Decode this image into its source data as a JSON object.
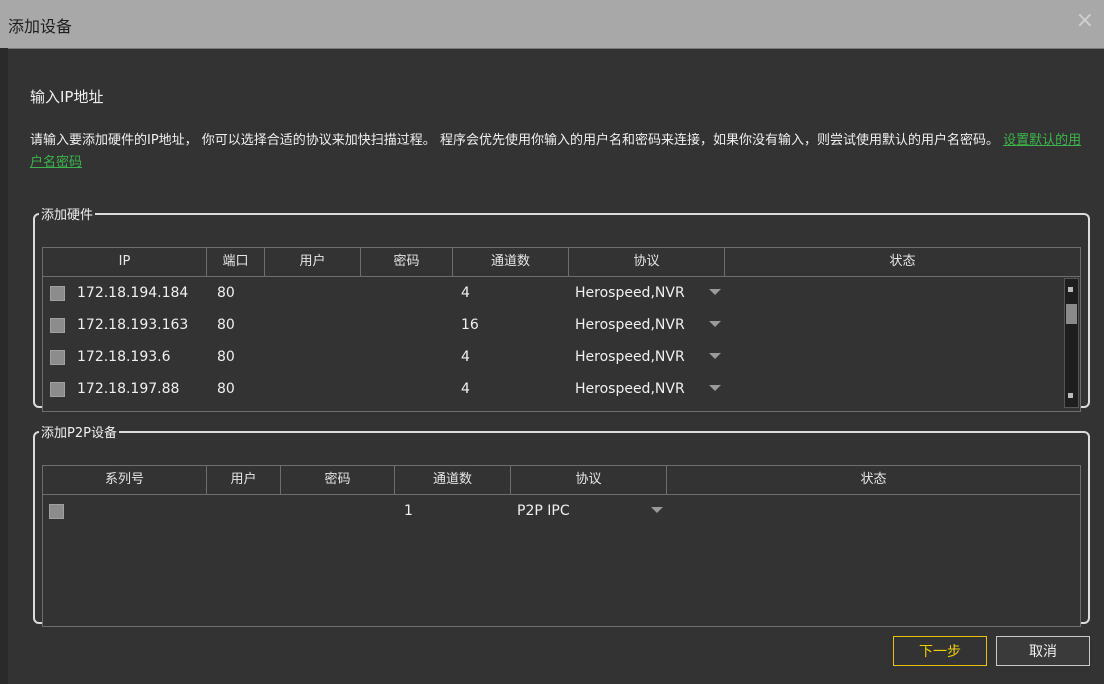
{
  "window": {
    "title": "添加设备",
    "close_icon": "×"
  },
  "heading": "输入IP地址",
  "description": {
    "text": "请输入要添加硬件的IP地址， 你可以选择合适的协议来加快扫描过程。 程序会优先使用你输入的用户名和密码来连接，如果你没有输入，则尝试使用默认的用户名密码。",
    "link": "设置默认的用户名密码"
  },
  "hardware_group": {
    "legend": "添加硬件",
    "columns": [
      "IP",
      "端口",
      "用户",
      "密码",
      "通道数",
      "协议",
      "状态"
    ],
    "rows": [
      {
        "ip": "172.18.194.184",
        "port": "80",
        "user": "",
        "password": "",
        "channels": "4",
        "protocol": "Herospeed,NVR",
        "status": ""
      },
      {
        "ip": "172.18.193.163",
        "port": "80",
        "user": "",
        "password": "",
        "channels": "16",
        "protocol": "Herospeed,NVR",
        "status": ""
      },
      {
        "ip": "172.18.193.6",
        "port": "80",
        "user": "",
        "password": "",
        "channels": "4",
        "protocol": "Herospeed,NVR",
        "status": ""
      },
      {
        "ip": "172.18.197.88",
        "port": "80",
        "user": "",
        "password": "",
        "channels": "4",
        "protocol": "Herospeed,NVR",
        "status": ""
      }
    ]
  },
  "p2p_group": {
    "legend": "添加P2P设备",
    "columns": [
      "系列号",
      "用户",
      "密码",
      "通道数",
      "协议",
      "状态"
    ],
    "rows": [
      {
        "serial": "",
        "user": "",
        "password": "",
        "channels": "1",
        "protocol": "P2P IPC",
        "status": ""
      }
    ]
  },
  "buttons": {
    "next": "下一步",
    "cancel": "取消"
  },
  "colors": {
    "accent_link": "#3cb44b",
    "primary_button_border": "#e6c200",
    "background": "#333333",
    "titlebar": "#a8a8a8"
  }
}
